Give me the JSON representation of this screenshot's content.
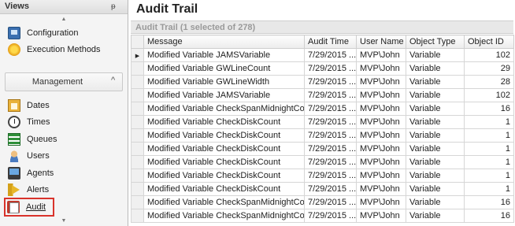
{
  "views": {
    "title": "Views",
    "pin": "ᵽ",
    "items_top": [
      {
        "label": "Configuration",
        "icon": "configuration-icon"
      },
      {
        "label": "Execution Methods",
        "icon": "execution-methods-icon"
      }
    ],
    "group": {
      "label": "Management",
      "chevron": "^"
    },
    "items": [
      {
        "label": "Dates",
        "icon": "calendar-icon"
      },
      {
        "label": "Times",
        "icon": "clock-icon"
      },
      {
        "label": "Queues",
        "icon": "queues-icon"
      },
      {
        "label": "Users",
        "icon": "user-icon"
      },
      {
        "label": "Agents",
        "icon": "computer-icon"
      },
      {
        "label": "Alerts",
        "icon": "megaphone-icon"
      },
      {
        "label": "Audit",
        "icon": "audit-icon",
        "selected": true
      }
    ]
  },
  "main": {
    "title": "Audit Trail",
    "caption": "Audit Trail (1 selected of 278)",
    "columns": [
      "Message",
      "Audit Time",
      "User Name",
      "Object Type",
      "Object ID"
    ],
    "rows": [
      {
        "message": "Modified Variable JAMSVariable",
        "time": "7/29/2015 ...",
        "user": "MVP\\John",
        "type": "Variable",
        "id": "102",
        "selected": true
      },
      {
        "message": "Modified Variable GWLineCount",
        "time": "7/29/2015 ...",
        "user": "MVP\\John",
        "type": "Variable",
        "id": "29"
      },
      {
        "message": "Modified Variable GWLineWidth",
        "time": "7/29/2015 ...",
        "user": "MVP\\John",
        "type": "Variable",
        "id": "28"
      },
      {
        "message": "Modified Variable JAMSVariable",
        "time": "7/29/2015 ...",
        "user": "MVP\\John",
        "type": "Variable",
        "id": "102"
      },
      {
        "message": "Modified Variable CheckSpanMidnightCount",
        "time": "7/29/2015 ...",
        "user": "MVP\\John",
        "type": "Variable",
        "id": "16"
      },
      {
        "message": "Modified Variable CheckDiskCount",
        "time": "7/29/2015 ...",
        "user": "MVP\\John",
        "type": "Variable",
        "id": "1"
      },
      {
        "message": "Modified Variable CheckDiskCount",
        "time": "7/29/2015 ...",
        "user": "MVP\\John",
        "type": "Variable",
        "id": "1"
      },
      {
        "message": "Modified Variable CheckDiskCount",
        "time": "7/29/2015 ...",
        "user": "MVP\\John",
        "type": "Variable",
        "id": "1"
      },
      {
        "message": "Modified Variable CheckDiskCount",
        "time": "7/29/2015 ...",
        "user": "MVP\\John",
        "type": "Variable",
        "id": "1"
      },
      {
        "message": "Modified Variable CheckDiskCount",
        "time": "7/29/2015 ...",
        "user": "MVP\\John",
        "type": "Variable",
        "id": "1"
      },
      {
        "message": "Modified Variable CheckDiskCount",
        "time": "7/29/2015 ...",
        "user": "MVP\\John",
        "type": "Variable",
        "id": "1"
      },
      {
        "message": "Modified Variable CheckSpanMidnightCount",
        "time": "7/29/2015 ...",
        "user": "MVP\\John",
        "type": "Variable",
        "id": "16"
      },
      {
        "message": "Modified Variable CheckSpanMidnightCount",
        "time": "7/29/2015 ...",
        "user": "MVP\\John",
        "type": "Variable",
        "id": "16"
      }
    ]
  },
  "colors": {
    "selection_outline": "#d9332b",
    "caption_text": "#9a9a9a"
  }
}
